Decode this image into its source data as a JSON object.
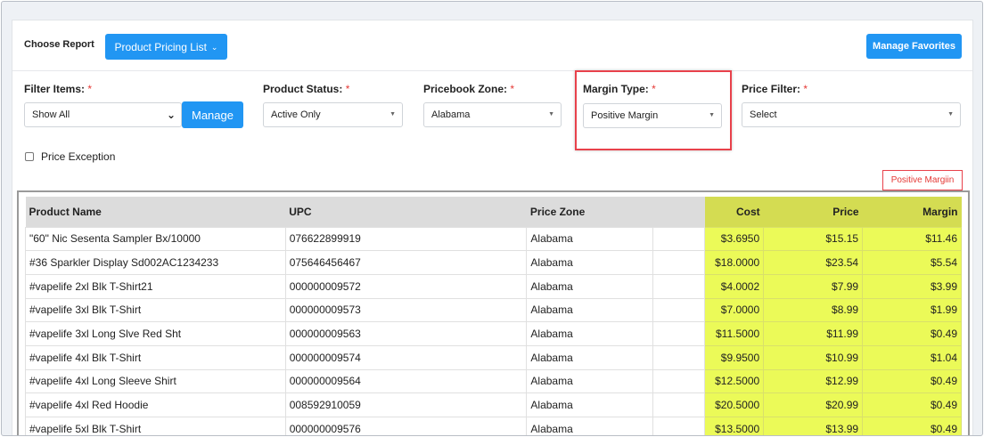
{
  "report": {
    "label": "Choose Report",
    "selected": "Product Pricing List"
  },
  "manage_favorites": "Manage Favorites",
  "filters": {
    "filter_items": {
      "label": "Filter Items:",
      "value": "Show All",
      "button": "Manage"
    },
    "product_status": {
      "label": "Product Status:",
      "value": "Active Only"
    },
    "pricebook_zone": {
      "label": "Pricebook Zone:",
      "value": "Alabama"
    },
    "margin_type": {
      "label": "Margin Type:",
      "value": "Positive Margin"
    },
    "price_filter": {
      "label": "Price Filter:",
      "value": "Select"
    },
    "required_mark": "*"
  },
  "price_exception": {
    "label": "Price Exception",
    "checked": false
  },
  "badge": "Positive Margiin",
  "table": {
    "columns": [
      "Product Name",
      "UPC",
      "Price Zone",
      "",
      "Cost",
      "Price",
      "Margin"
    ],
    "rows": [
      [
        "\"60\" Nic Sesenta Sampler Bx/10000",
        "076622899919",
        "Alabama",
        "",
        "$3.6950",
        "$15.15",
        "$11.46"
      ],
      [
        "#36 Sparkler Display Sd002AC1234233",
        "075646456467",
        "Alabama",
        "",
        "$18.0000",
        "$23.54",
        "$5.54"
      ],
      [
        "#vapelife 2xl Blk T-Shirt21",
        "000000009572",
        "Alabama",
        "",
        "$4.0002",
        "$7.99",
        "$3.99"
      ],
      [
        "#vapelife 3xl Blk T-Shirt",
        "000000009573",
        "Alabama",
        "",
        "$7.0000",
        "$8.99",
        "$1.99"
      ],
      [
        "#vapelife 3xl Long Slve Red Sht",
        "000000009563",
        "Alabama",
        "",
        "$11.5000",
        "$11.99",
        "$0.49"
      ],
      [
        "#vapelife 4xl Blk T-Shirt",
        "000000009574",
        "Alabama",
        "",
        "$9.9500",
        "$10.99",
        "$1.04"
      ],
      [
        "#vapelife 4xl Long Sleeve Shirt",
        "000000009564",
        "Alabama",
        "",
        "$12.5000",
        "$12.99",
        "$0.49"
      ],
      [
        "#vapelife 4xl Red Hoodie",
        "008592910059",
        "Alabama",
        "",
        "$20.5000",
        "$20.99",
        "$0.49"
      ],
      [
        "#vapelife 5xl Blk T-Shirt",
        "000000009576",
        "Alabama",
        "",
        "$13.5000",
        "$13.99",
        "$0.49"
      ]
    ]
  },
  "colors": {
    "accent": "#2196f3",
    "highlight": "#ebfa58",
    "alert": "#e8414b"
  }
}
